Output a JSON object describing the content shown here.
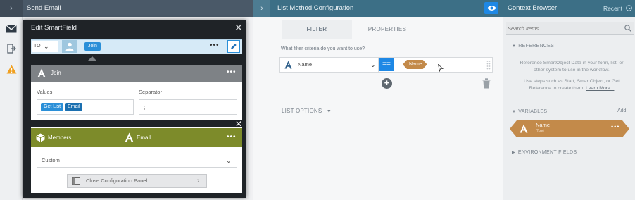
{
  "rail": {
    "collapse_glyph": "›",
    "icons": [
      "envelope-icon",
      "exit-icon",
      "warning-icon"
    ]
  },
  "send_panel": {
    "title": "Send Email"
  },
  "dialog": {
    "title": "Edit SmartField",
    "close_glyph": "✕",
    "to_field": {
      "label": "TO",
      "token": "Join",
      "more": "•••"
    },
    "join_block": {
      "label": "Join",
      "more": "•••",
      "values_label": "Values",
      "separator_label": "Separator",
      "values_tokens": [
        "Get List",
        "Email"
      ],
      "separator_value": ";"
    },
    "members_block": {
      "label": "Members",
      "email_label": "Email",
      "more": "•••",
      "select_value": "Custom"
    },
    "close_config_label": "Close Configuration Panel"
  },
  "list_method": {
    "title": "List Method Configuration",
    "tabs": [
      "FILTER",
      "PROPERTIES"
    ],
    "filter_question": "What filter criteria do you want to use?",
    "condition": {
      "field": "Name",
      "operator": "==",
      "value": "Name"
    },
    "list_options": "LIST OPTIONS"
  },
  "context_browser": {
    "title": "Context Browser",
    "recent": "Recent",
    "search_placeholder": "Search Items",
    "references_heading": "REFERENCES",
    "references_text_1": "Reference SmartObject Data in your form, list, or other system to use in the workflow.",
    "references_text_2": "Use steps such as Start, SmartObject, or Get Reference to create them.",
    "learn_more": "Learn More...",
    "variables_heading": "VARIABLES",
    "add_label": "Add",
    "variable": {
      "name": "Name",
      "type": "Text",
      "more": "•••"
    },
    "environment_heading": "ENVIRONMENT FIELDS"
  },
  "colors": {
    "accent_blue": "#1e88e5",
    "header_teal": "#3c6f86",
    "members_olive": "#7d8b2a",
    "variable_tan": "#c38a4a",
    "warning": "#f0a020"
  }
}
